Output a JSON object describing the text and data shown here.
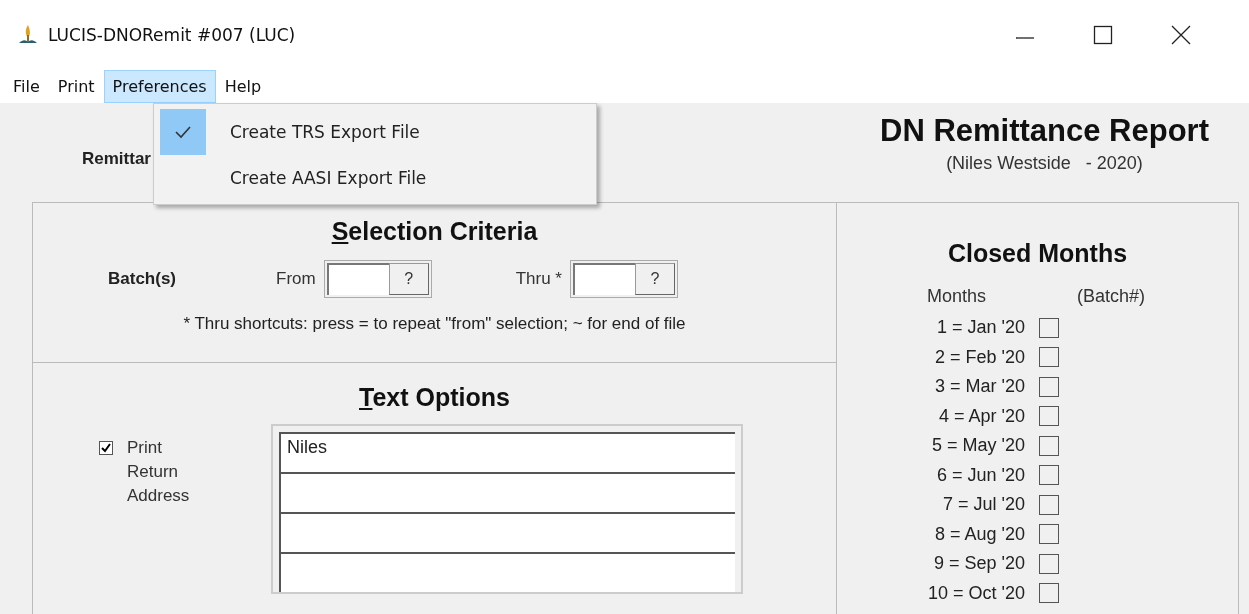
{
  "window": {
    "title": "LUCIS-DNORemit #007 (LUC)"
  },
  "menu": [
    {
      "label": "File",
      "selected": false
    },
    {
      "label": "Print",
      "selected": false
    },
    {
      "label": "Preferences",
      "selected": true
    },
    {
      "label": "Help",
      "selected": false
    }
  ],
  "dropdown": {
    "items": [
      {
        "label": "Create TRS Export File",
        "checked": true
      },
      {
        "label": "Create AASI Export File",
        "checked": false
      }
    ]
  },
  "header": {
    "left_label": "Remittar",
    "title": "DN Remittance Report",
    "subtitle": "(Niles Westside   - 2020)"
  },
  "selection": {
    "heading": "Selection Criteria",
    "batch_label": "Batch(s)",
    "range": [
      {
        "label": "From",
        "button": "?"
      },
      {
        "label": "Thru *",
        "button": "?"
      }
    ],
    "note": "* Thru shortcuts: press = to repeat \"from\" selection; ~ for end of file"
  },
  "text_options": {
    "heading": "Text Options",
    "checkbox": {
      "label": "Print Return Address",
      "checked": true
    },
    "address_lines": [
      "Niles"
    ]
  },
  "closed_months": {
    "heading": "Closed Months",
    "columns": [
      "Months",
      "(Batch#)"
    ],
    "months": [
      {
        "label": "1 = Jan '20",
        "checked": false
      },
      {
        "label": "2 = Feb '20",
        "checked": false
      },
      {
        "label": "3 = Mar '20",
        "checked": false
      },
      {
        "label": "4 = Apr '20",
        "checked": false
      },
      {
        "label": "5 = May '20",
        "checked": false
      },
      {
        "label": "6 = Jun '20",
        "checked": false
      },
      {
        "label": "7 = Jul '20",
        "checked": false
      },
      {
        "label": "8 = Aug '20",
        "checked": false
      },
      {
        "label": "9 = Sep '20",
        "checked": false
      },
      {
        "label": "10 = Oct '20",
        "checked": false
      }
    ]
  }
}
